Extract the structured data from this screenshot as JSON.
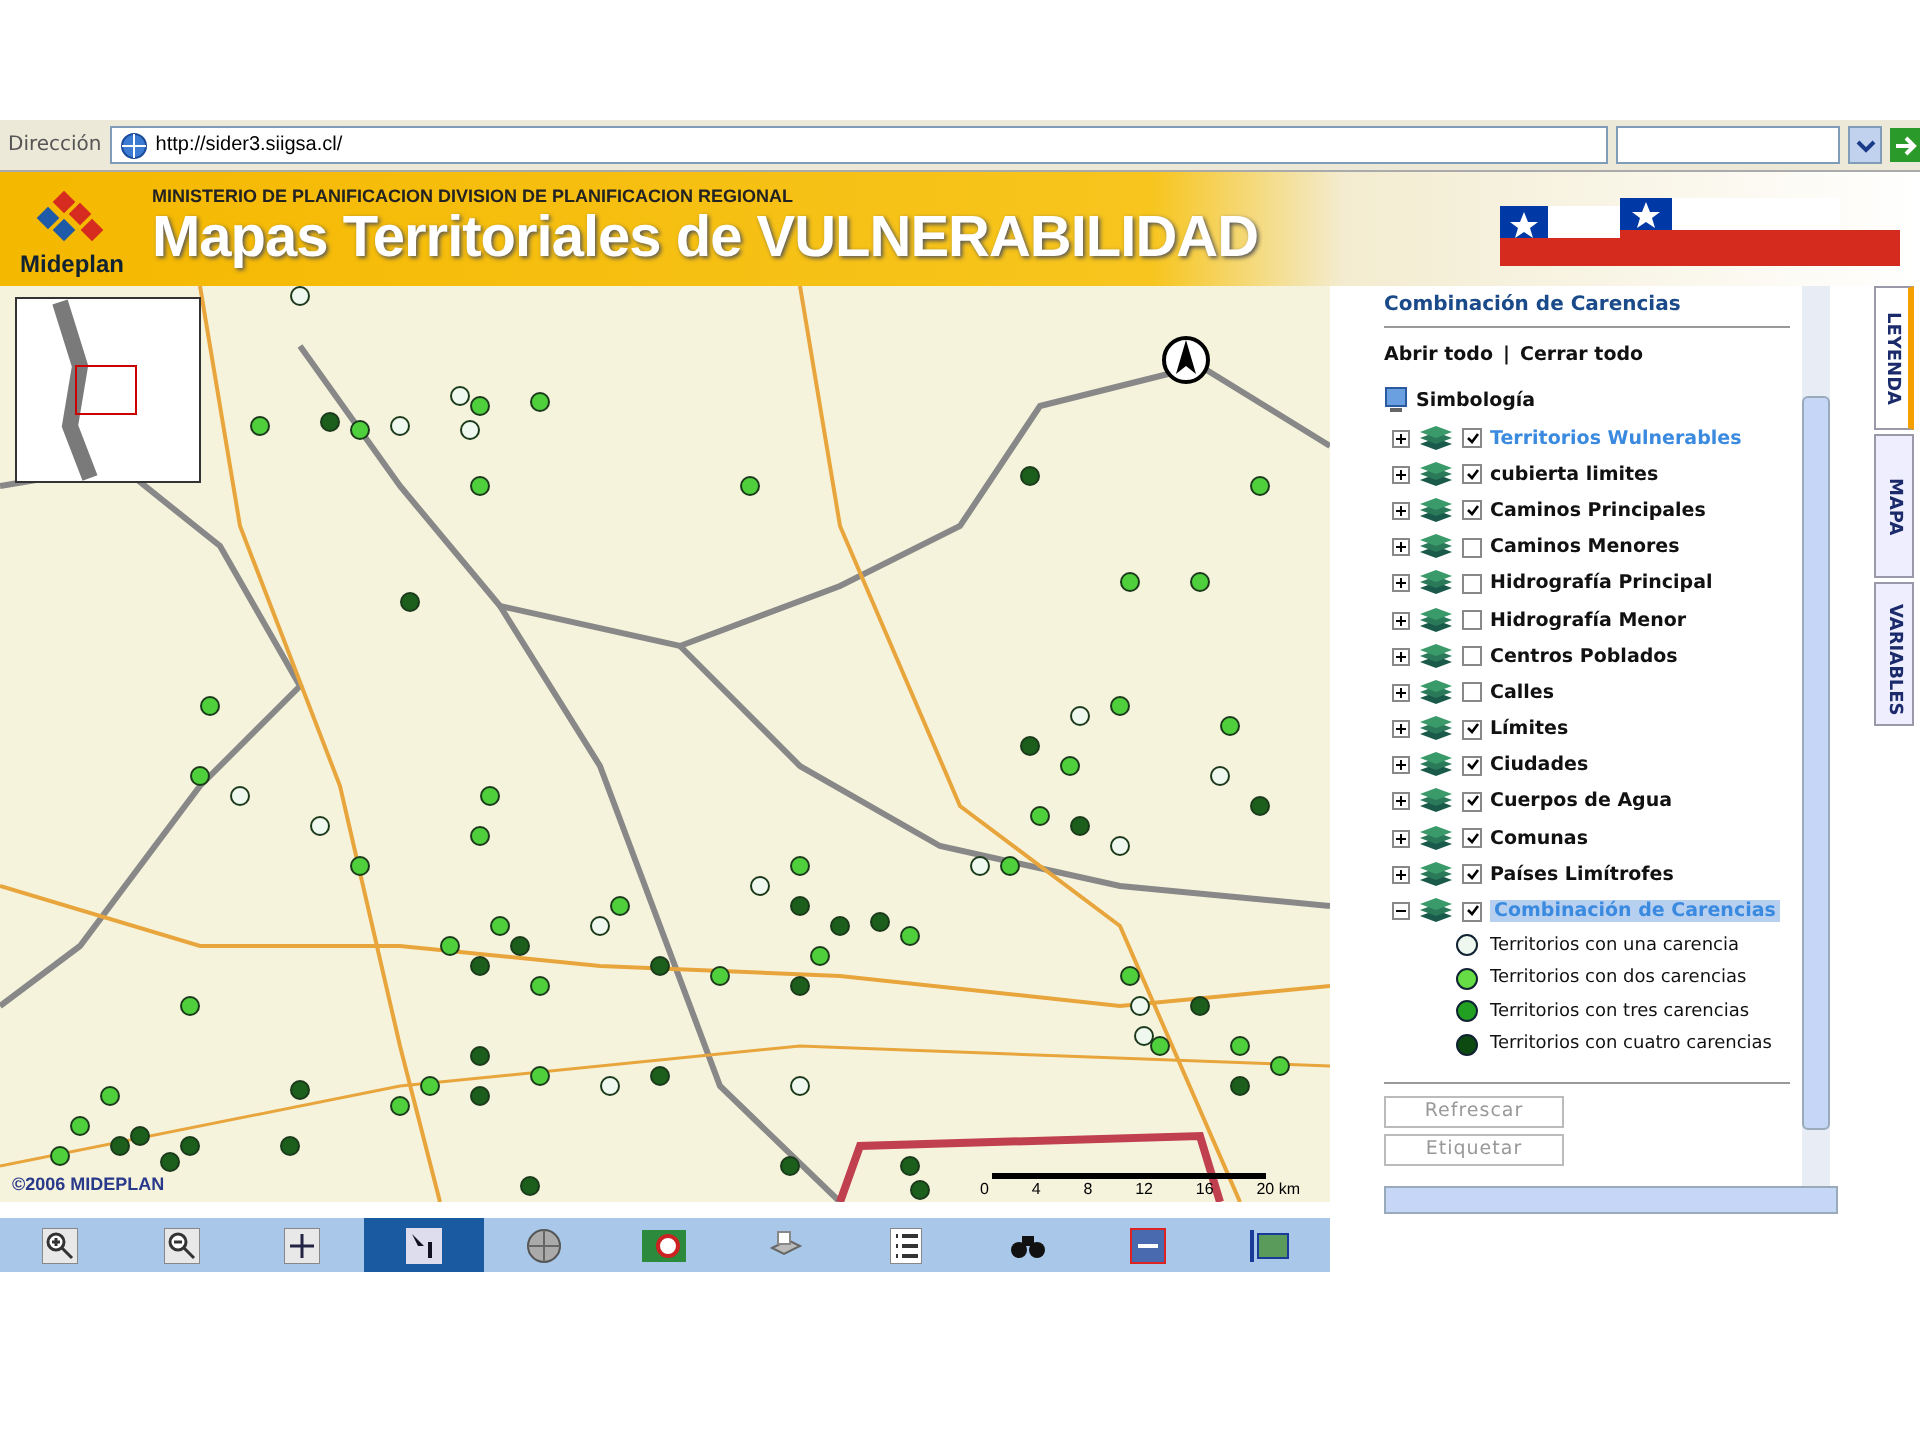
{
  "address_bar": {
    "label": "Dirección",
    "url": "http://sider3.siigsa.cl/"
  },
  "header": {
    "logo_text": "Mideplan",
    "subtitle": "MINISTERIO DE PLANIFICACION DIVISION DE PLANIFICACION REGIONAL",
    "title": "Mapas Territoriales de VULNERABILIDAD"
  },
  "map": {
    "copyright": "©2006 MIDEPLAN",
    "scale_labels": [
      "0",
      "4",
      "8",
      "12",
      "16",
      "20 km"
    ]
  },
  "toolbar": [
    {
      "kind": "zoomin",
      "selected": false
    },
    {
      "kind": "zoomout",
      "selected": false
    },
    {
      "kind": "pan",
      "selected": false
    },
    {
      "kind": "info",
      "selected": true
    },
    {
      "kind": "globe",
      "selected": false
    },
    {
      "kind": "map",
      "selected": false
    },
    {
      "kind": "print",
      "selected": false
    },
    {
      "kind": "list",
      "selected": false
    },
    {
      "kind": "find",
      "selected": false
    },
    {
      "kind": "measure",
      "selected": false
    },
    {
      "kind": "extent",
      "selected": false
    }
  ],
  "panel": {
    "title": "Combinación de Carencias",
    "open_all": "Abrir todo",
    "separator": "|",
    "close_all": "Cerrar todo",
    "root": "Simbología",
    "layers": [
      {
        "label": "Territorios Wulnerables",
        "kind": "link",
        "checked": true,
        "expanded": false,
        "selected": false
      },
      {
        "label": "cubierta limites",
        "kind": "layer",
        "checked": true,
        "expanded": false,
        "selected": false
      },
      {
        "label": "Caminos Principales",
        "kind": "layer",
        "checked": true,
        "expanded": false,
        "selected": false
      },
      {
        "label": "Caminos Menores",
        "kind": "layer",
        "checked": false,
        "expanded": false,
        "selected": false
      },
      {
        "label": "Hidrografía Principal",
        "kind": "layer",
        "checked": false,
        "expanded": false,
        "selected": false
      },
      {
        "label": "Hidrografía Menor",
        "kind": "layer",
        "checked": false,
        "expanded": false,
        "selected": false
      },
      {
        "label": "Centros Poblados",
        "kind": "layer",
        "checked": false,
        "expanded": false,
        "selected": false
      },
      {
        "label": "Calles",
        "kind": "layer",
        "checked": false,
        "expanded": false,
        "selected": false
      },
      {
        "label": "Límites",
        "kind": "layer",
        "checked": true,
        "expanded": false,
        "selected": false
      },
      {
        "label": "Ciudades",
        "kind": "layer",
        "checked": true,
        "expanded": false,
        "selected": false
      },
      {
        "label": "Cuerpos de  Agua",
        "kind": "layer",
        "checked": true,
        "expanded": false,
        "selected": false
      },
      {
        "label": "Comunas",
        "kind": "layer",
        "checked": true,
        "expanded": false,
        "selected": false
      },
      {
        "label": "Países Limítrofes",
        "kind": "layer",
        "checked": true,
        "expanded": false,
        "selected": false
      },
      {
        "label": "Combinación de Carencias",
        "kind": "layer",
        "checked": true,
        "expanded": true,
        "selected": true,
        "children": [
          {
            "label": "Territorios  con una carencia",
            "color": "#eef8ee"
          },
          {
            "label": "Territorios  con dos carencias",
            "color": "#66dd44"
          },
          {
            "label": "Territorios  con tres carencias",
            "color": "#22a022"
          },
          {
            "label": "Territorios  con cuatro carencias",
            "color": "#0c4a12"
          }
        ]
      }
    ],
    "buttons": [
      "Refrescar",
      "Etiquetar"
    ]
  },
  "tabs": [
    {
      "label": "LEYENDA",
      "selected": true
    },
    {
      "label": "MAPA",
      "selected": false
    },
    {
      "label": "VARIABLES",
      "selected": false
    }
  ]
}
